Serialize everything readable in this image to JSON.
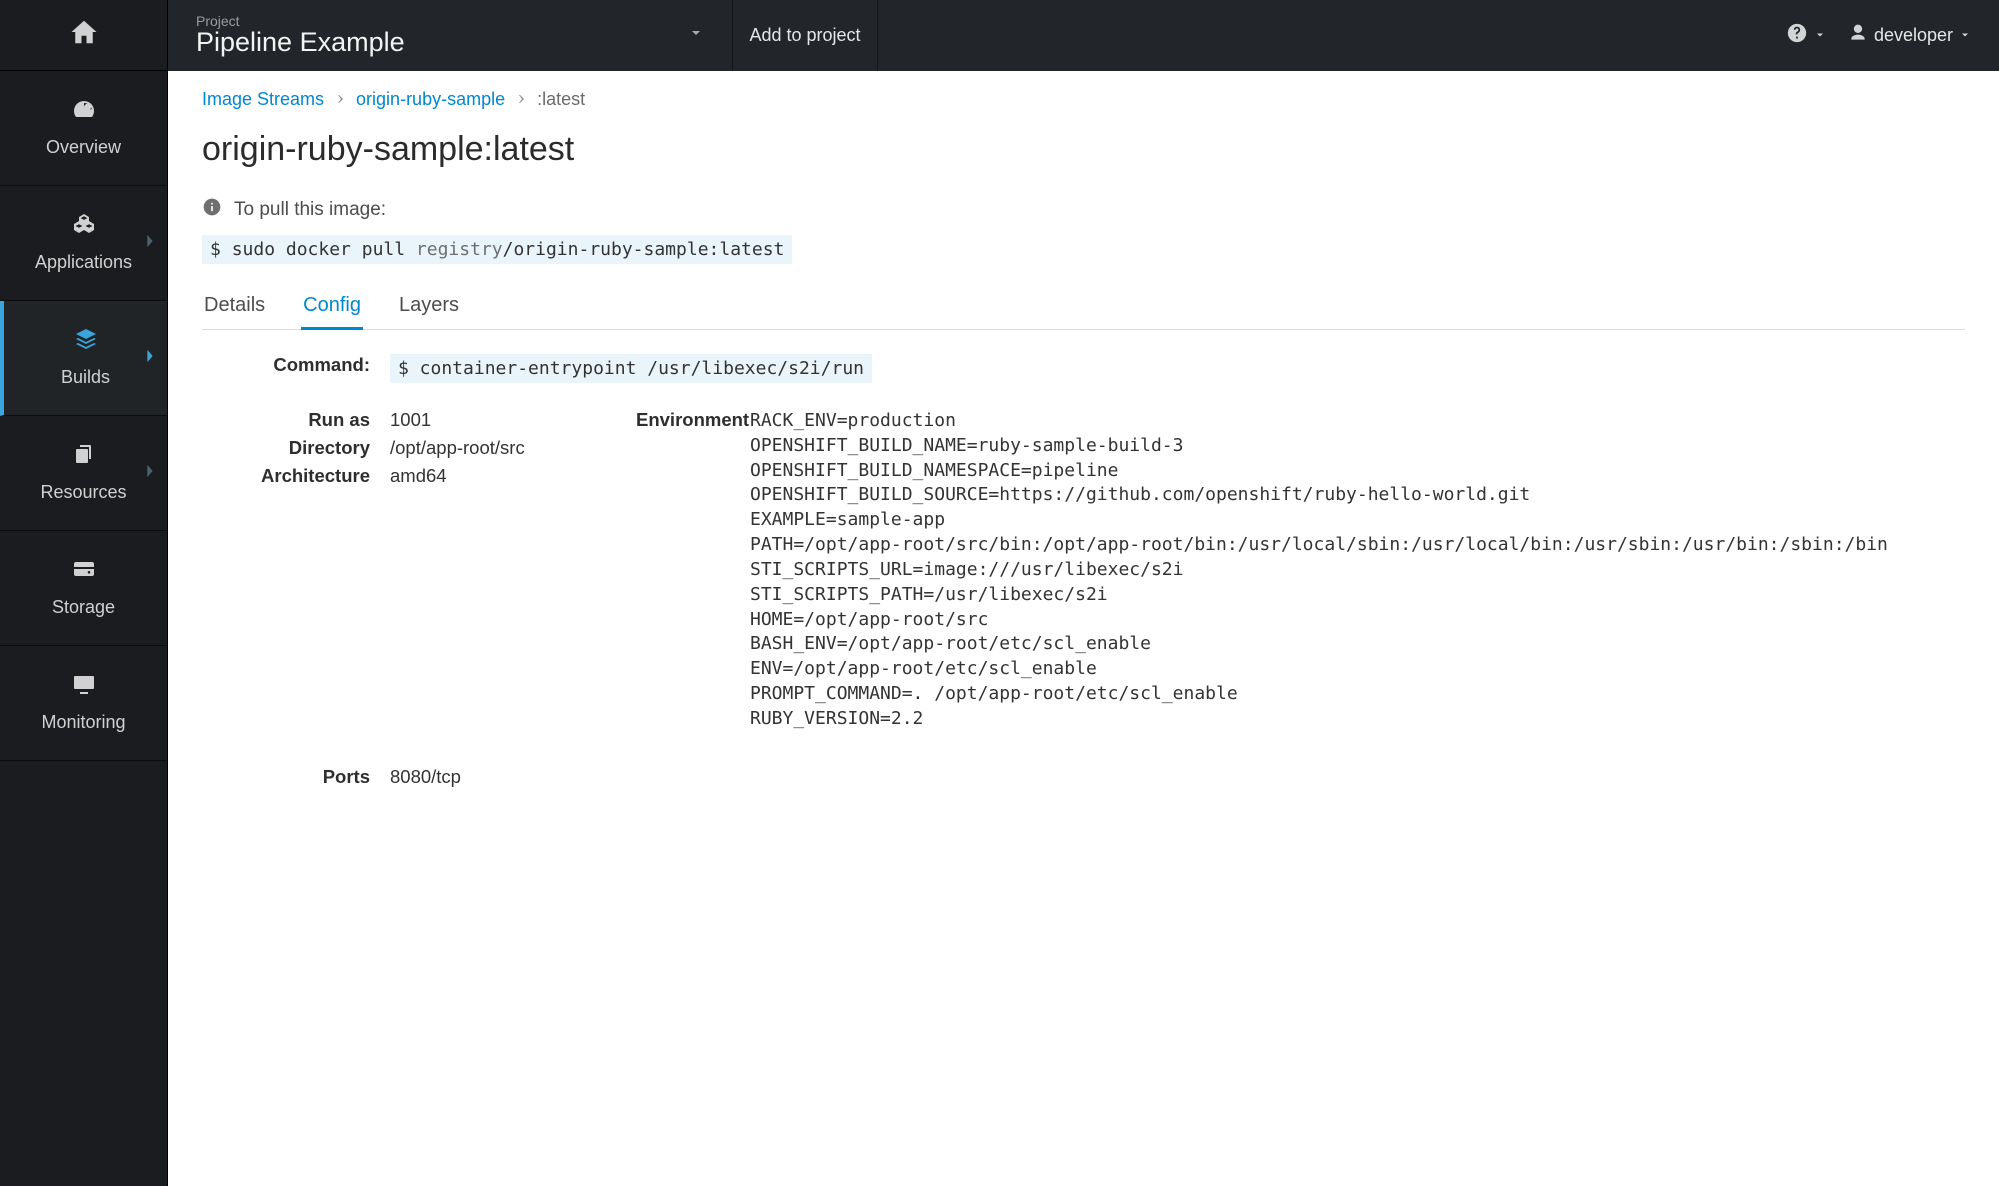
{
  "sidebar": {
    "items": [
      {
        "label": "Overview",
        "icon": "dashboard"
      },
      {
        "label": "Applications",
        "icon": "cubes",
        "caret": true
      },
      {
        "label": "Builds",
        "icon": "layers",
        "caret": true,
        "active": true
      },
      {
        "label": "Resources",
        "icon": "copy",
        "caret": true
      },
      {
        "label": "Storage",
        "icon": "hdd"
      },
      {
        "label": "Monitoring",
        "icon": "monitor"
      }
    ]
  },
  "topbar": {
    "project_small": "Project",
    "project_name": "Pipeline Example",
    "add_to_project": "Add to project",
    "user": "developer"
  },
  "breadcrumb": {
    "a": "Image Streams",
    "b": "origin-ruby-sample",
    "c": ":latest"
  },
  "title": "origin-ruby-sample:latest",
  "pull_hint": "To pull this image:",
  "pull_cmd": {
    "prompt": "$ ",
    "pre": "sudo docker pull ",
    "dim": "registry",
    "post": "/origin-ruby-sample:latest"
  },
  "tabs": {
    "details": "Details",
    "config": "Config",
    "layers": "Layers"
  },
  "config": {
    "command_label": "Command:",
    "command_value": "$ container-entrypoint /usr/libexec/s2i/run",
    "runas_label": "Run as",
    "runas_value": "1001",
    "dir_label": "Directory",
    "dir_value": "/opt/app-root/src",
    "arch_label": "Architecture",
    "arch_value": "amd64",
    "env_label": "Environment",
    "env": [
      "RACK_ENV=production",
      "OPENSHIFT_BUILD_NAME=ruby-sample-build-3",
      "OPENSHIFT_BUILD_NAMESPACE=pipeline",
      "OPENSHIFT_BUILD_SOURCE=https://github.com/openshift/ruby-hello-world.git",
      "EXAMPLE=sample-app",
      "PATH=/opt/app-root/src/bin:/opt/app-root/bin:/usr/local/sbin:/usr/local/bin:/usr/sbin:/usr/bin:/sbin:/bin",
      "STI_SCRIPTS_URL=image:///usr/libexec/s2i",
      "STI_SCRIPTS_PATH=/usr/libexec/s2i",
      "HOME=/opt/app-root/src",
      "BASH_ENV=/opt/app-root/etc/scl_enable",
      "ENV=/opt/app-root/etc/scl_enable",
      "PROMPT_COMMAND=. /opt/app-root/etc/scl_enable",
      "RUBY_VERSION=2.2"
    ],
    "ports_label": "Ports",
    "ports_value": "8080/tcp"
  }
}
